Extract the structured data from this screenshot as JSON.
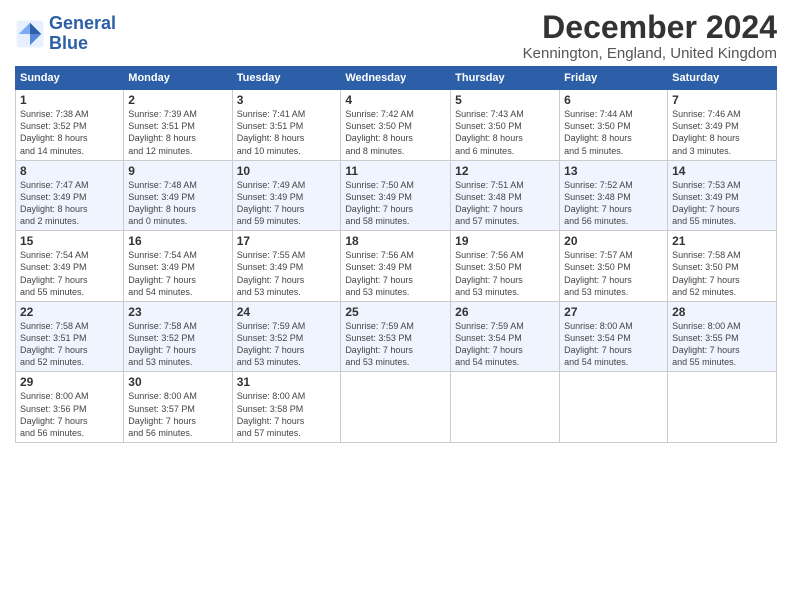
{
  "logo": {
    "line1": "General",
    "line2": "Blue"
  },
  "title": "December 2024",
  "location": "Kennington, England, United Kingdom",
  "days_of_week": [
    "Sunday",
    "Monday",
    "Tuesday",
    "Wednesday",
    "Thursday",
    "Friday",
    "Saturday"
  ],
  "weeks": [
    [
      {
        "day": "1",
        "info": "Sunrise: 7:38 AM\nSunset: 3:52 PM\nDaylight: 8 hours\nand 14 minutes."
      },
      {
        "day": "2",
        "info": "Sunrise: 7:39 AM\nSunset: 3:51 PM\nDaylight: 8 hours\nand 12 minutes."
      },
      {
        "day": "3",
        "info": "Sunrise: 7:41 AM\nSunset: 3:51 PM\nDaylight: 8 hours\nand 10 minutes."
      },
      {
        "day": "4",
        "info": "Sunrise: 7:42 AM\nSunset: 3:50 PM\nDaylight: 8 hours\nand 8 minutes."
      },
      {
        "day": "5",
        "info": "Sunrise: 7:43 AM\nSunset: 3:50 PM\nDaylight: 8 hours\nand 6 minutes."
      },
      {
        "day": "6",
        "info": "Sunrise: 7:44 AM\nSunset: 3:50 PM\nDaylight: 8 hours\nand 5 minutes."
      },
      {
        "day": "7",
        "info": "Sunrise: 7:46 AM\nSunset: 3:49 PM\nDaylight: 8 hours\nand 3 minutes."
      }
    ],
    [
      {
        "day": "8",
        "info": "Sunrise: 7:47 AM\nSunset: 3:49 PM\nDaylight: 8 hours\nand 2 minutes."
      },
      {
        "day": "9",
        "info": "Sunrise: 7:48 AM\nSunset: 3:49 PM\nDaylight: 8 hours\nand 0 minutes."
      },
      {
        "day": "10",
        "info": "Sunrise: 7:49 AM\nSunset: 3:49 PM\nDaylight: 7 hours\nand 59 minutes."
      },
      {
        "day": "11",
        "info": "Sunrise: 7:50 AM\nSunset: 3:49 PM\nDaylight: 7 hours\nand 58 minutes."
      },
      {
        "day": "12",
        "info": "Sunrise: 7:51 AM\nSunset: 3:48 PM\nDaylight: 7 hours\nand 57 minutes."
      },
      {
        "day": "13",
        "info": "Sunrise: 7:52 AM\nSunset: 3:48 PM\nDaylight: 7 hours\nand 56 minutes."
      },
      {
        "day": "14",
        "info": "Sunrise: 7:53 AM\nSunset: 3:49 PM\nDaylight: 7 hours\nand 55 minutes."
      }
    ],
    [
      {
        "day": "15",
        "info": "Sunrise: 7:54 AM\nSunset: 3:49 PM\nDaylight: 7 hours\nand 55 minutes."
      },
      {
        "day": "16",
        "info": "Sunrise: 7:54 AM\nSunset: 3:49 PM\nDaylight: 7 hours\nand 54 minutes."
      },
      {
        "day": "17",
        "info": "Sunrise: 7:55 AM\nSunset: 3:49 PM\nDaylight: 7 hours\nand 53 minutes."
      },
      {
        "day": "18",
        "info": "Sunrise: 7:56 AM\nSunset: 3:49 PM\nDaylight: 7 hours\nand 53 minutes."
      },
      {
        "day": "19",
        "info": "Sunrise: 7:56 AM\nSunset: 3:50 PM\nDaylight: 7 hours\nand 53 minutes."
      },
      {
        "day": "20",
        "info": "Sunrise: 7:57 AM\nSunset: 3:50 PM\nDaylight: 7 hours\nand 53 minutes."
      },
      {
        "day": "21",
        "info": "Sunrise: 7:58 AM\nSunset: 3:50 PM\nDaylight: 7 hours\nand 52 minutes."
      }
    ],
    [
      {
        "day": "22",
        "info": "Sunrise: 7:58 AM\nSunset: 3:51 PM\nDaylight: 7 hours\nand 52 minutes."
      },
      {
        "day": "23",
        "info": "Sunrise: 7:58 AM\nSunset: 3:52 PM\nDaylight: 7 hours\nand 53 minutes."
      },
      {
        "day": "24",
        "info": "Sunrise: 7:59 AM\nSunset: 3:52 PM\nDaylight: 7 hours\nand 53 minutes."
      },
      {
        "day": "25",
        "info": "Sunrise: 7:59 AM\nSunset: 3:53 PM\nDaylight: 7 hours\nand 53 minutes."
      },
      {
        "day": "26",
        "info": "Sunrise: 7:59 AM\nSunset: 3:54 PM\nDaylight: 7 hours\nand 54 minutes."
      },
      {
        "day": "27",
        "info": "Sunrise: 8:00 AM\nSunset: 3:54 PM\nDaylight: 7 hours\nand 54 minutes."
      },
      {
        "day": "28",
        "info": "Sunrise: 8:00 AM\nSunset: 3:55 PM\nDaylight: 7 hours\nand 55 minutes."
      }
    ],
    [
      {
        "day": "29",
        "info": "Sunrise: 8:00 AM\nSunset: 3:56 PM\nDaylight: 7 hours\nand 56 minutes."
      },
      {
        "day": "30",
        "info": "Sunrise: 8:00 AM\nSunset: 3:57 PM\nDaylight: 7 hours\nand 56 minutes."
      },
      {
        "day": "31",
        "info": "Sunrise: 8:00 AM\nSunset: 3:58 PM\nDaylight: 7 hours\nand 57 minutes."
      },
      null,
      null,
      null,
      null
    ]
  ]
}
